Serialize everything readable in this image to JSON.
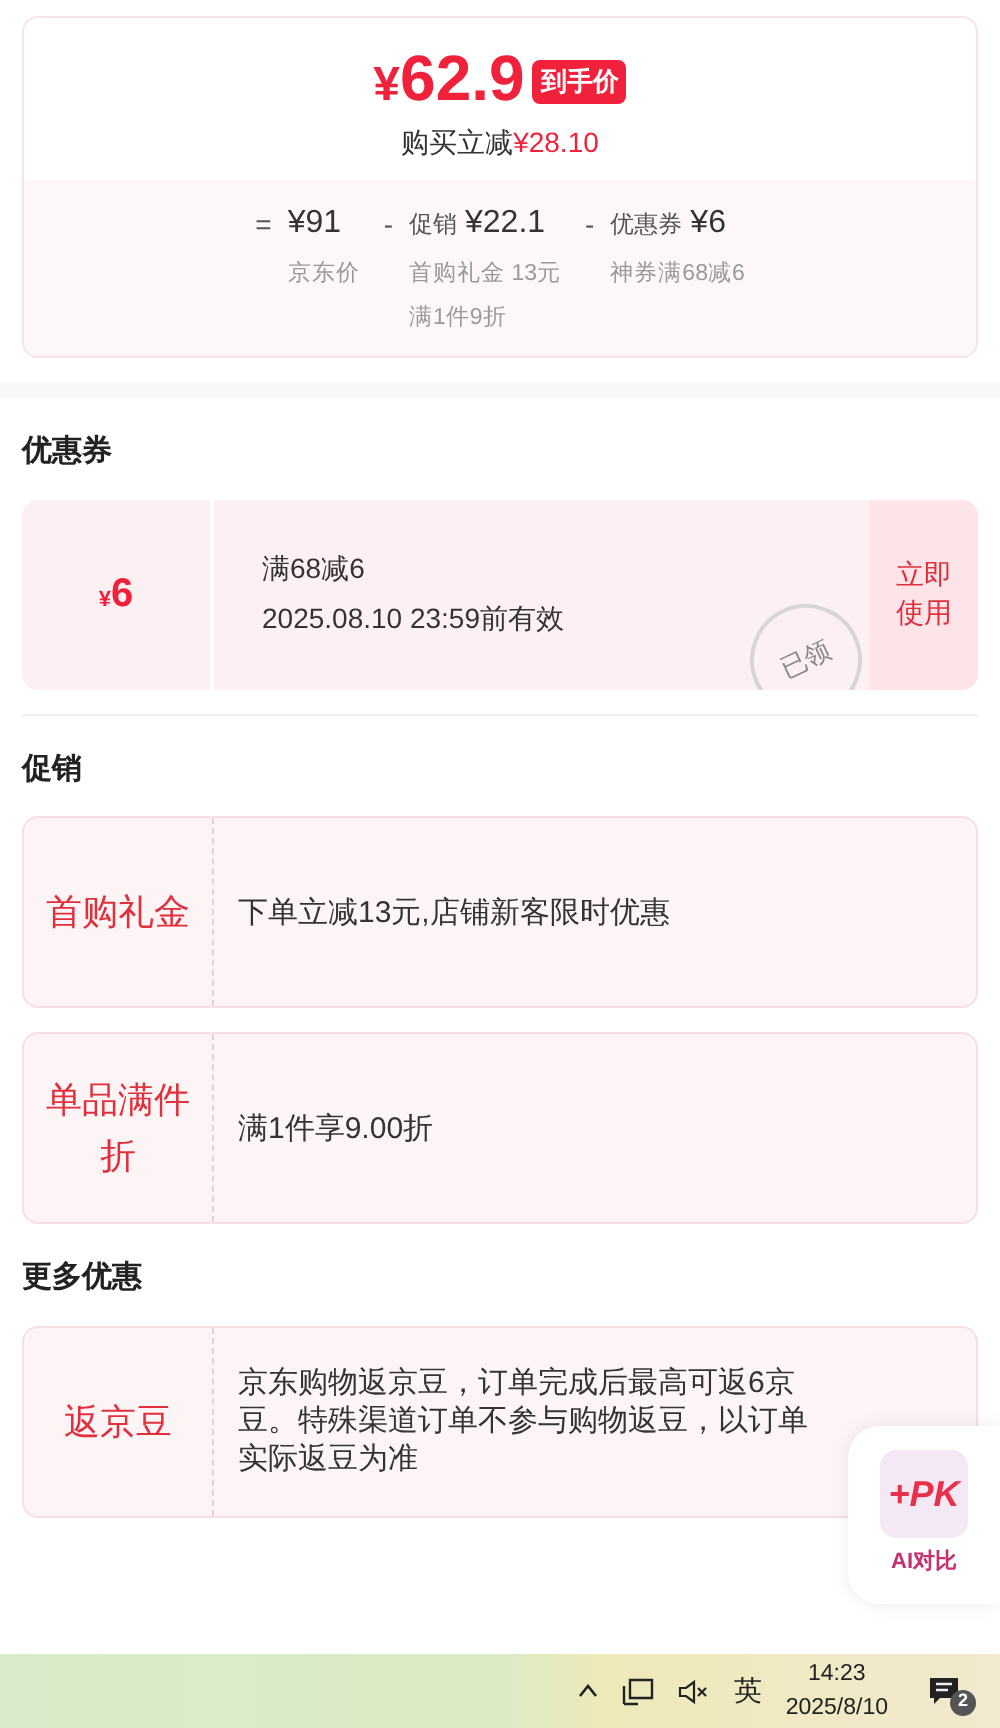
{
  "price": {
    "currency": "¥",
    "value": "62.9",
    "badge": "到手价",
    "savings_label": "购买立减",
    "savings_amount": "¥28.10"
  },
  "breakdown": [
    {
      "op": "=",
      "amount": "¥91",
      "notes": [
        "京东价"
      ]
    },
    {
      "op": "-",
      "label": "促销",
      "amount": "¥22.1",
      "notes": [
        "首购礼金 13元",
        "满1件9折"
      ]
    },
    {
      "op": "-",
      "label": "优惠券",
      "amount": "¥6",
      "notes": [
        "神券满68减6"
      ]
    }
  ],
  "coupon_section": {
    "title": "优惠券",
    "coupon": {
      "currency": "¥",
      "value": "6",
      "condition": "满68减6",
      "validity": "2025.08.10 23:59前有效",
      "stamp": "已领",
      "action": "立即使用"
    }
  },
  "promo_section": {
    "title": "促销",
    "items": [
      {
        "tag": "首购礼金",
        "text": "下单立减13元,店铺新客限时优惠"
      },
      {
        "tag": "单品满件折",
        "text": "满1件享9.00折"
      }
    ]
  },
  "more_section": {
    "title": "更多优惠",
    "items": [
      {
        "tag": "返京豆",
        "text": "京东购物返京豆，订单完成后最高可返6京豆。特殊渠道订单不参与购物返豆，以订单实际返豆为准"
      }
    ]
  },
  "floating_button": {
    "label": "AI对比",
    "icon_text": "+PK"
  },
  "taskbar": {
    "ime": "英",
    "time": "14:23",
    "date": "2025/8/10",
    "notifications": "2"
  }
}
